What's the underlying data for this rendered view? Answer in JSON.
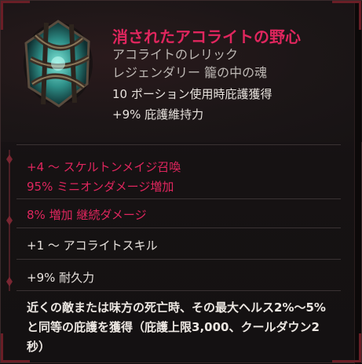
{
  "item": {
    "name": "消されたアコライトの野心",
    "subtype": "アコライトのレリック",
    "rarity": "レジェンダリー 籠の中の魂",
    "base_stats": [
      "10 ポーション使用時庇護獲得",
      "+9% 庇護維持力"
    ],
    "affix_groups": [
      [
        "+4 〜 スケルトンメイジ召喚",
        "95% ミニオンダメージ増加"
      ],
      [
        "8% 増加 継続ダメージ"
      ],
      [
        "+1 〜 アコライトスキル"
      ],
      [
        "+9% 耐久力"
      ]
    ],
    "unique_effect_lines": [
      "近くの敵または味方の死亡時、その最大ヘルス2%〜5%",
      "と同等の庇護を獲得（庇護上限3,000、クールダウン2",
      "秒）"
    ]
  },
  "colors": {
    "legendary_accent": "#e0265e",
    "text_primary": "#e8e3de",
    "text_muted": "#bdb8b4",
    "background": "#161213"
  },
  "icons": {
    "item_icon": "relic-icon"
  }
}
